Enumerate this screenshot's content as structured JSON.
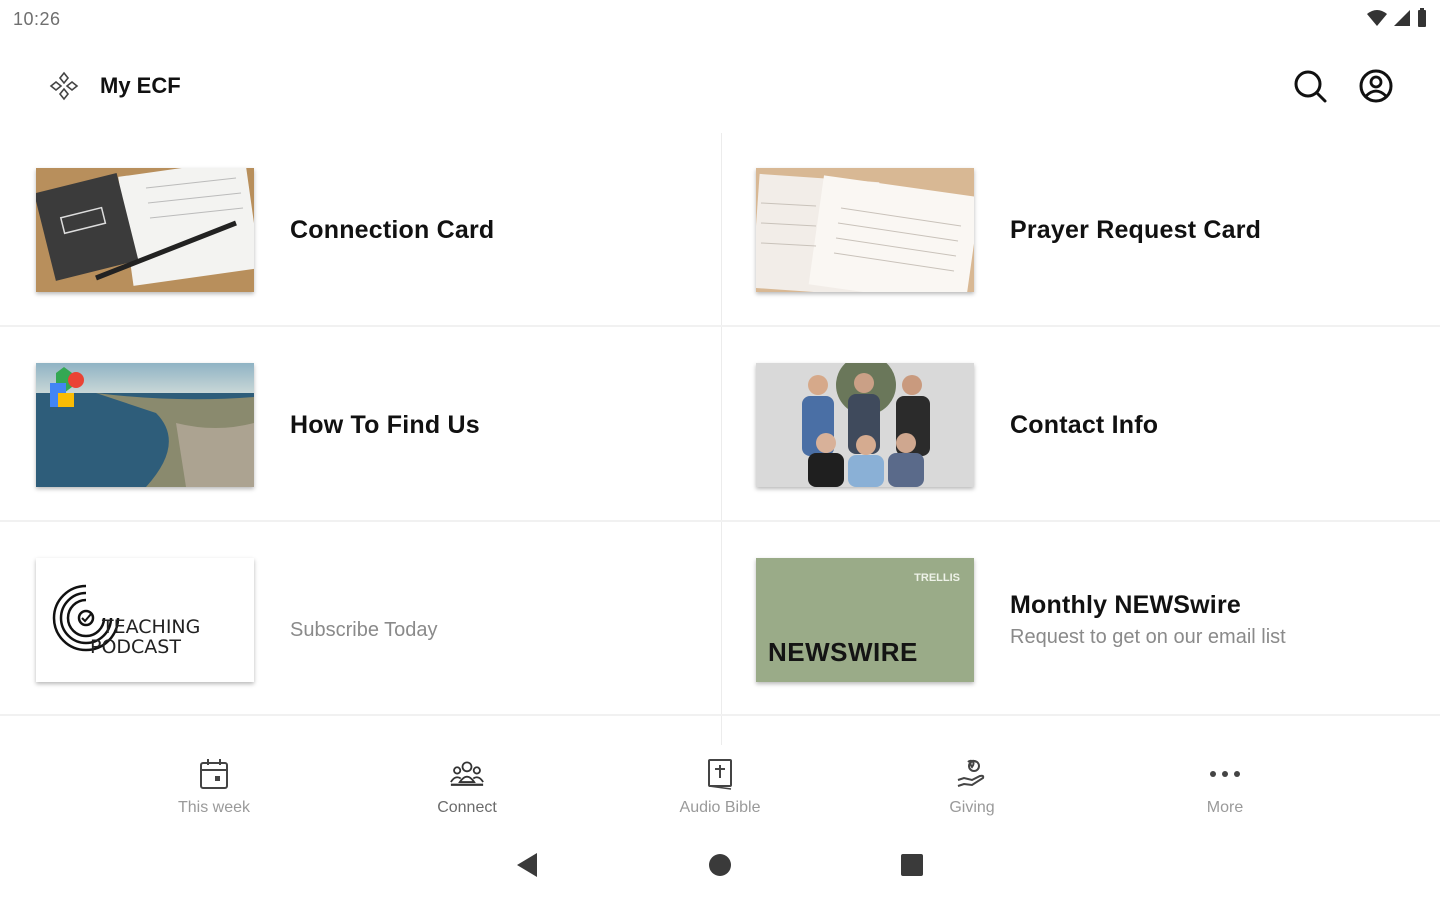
{
  "status_bar": {
    "time": "10:26"
  },
  "app_bar": {
    "title": "My ECF",
    "logo_icon": "ecf-logo-icon",
    "search_icon": "search-icon",
    "account_icon": "account-circle-icon"
  },
  "cards": [
    {
      "title": "Connection Card",
      "subtitle": "",
      "thumb": "connection-card-photo"
    },
    {
      "title": "Prayer Request Card",
      "subtitle": "",
      "thumb": "prayer-card-photo"
    },
    {
      "title": "How To Find Us",
      "subtitle": "",
      "thumb": "aerial-map-photo"
    },
    {
      "title": "Contact Info",
      "subtitle": "",
      "thumb": "staff-group-photo"
    },
    {
      "title": "",
      "subtitle": "Subscribe Today",
      "thumb": "teaching-podcast-logo",
      "thumb_text_1": "TEACHING",
      "thumb_text_2": "PODCAST"
    },
    {
      "title": "Monthly NEWSwire",
      "subtitle": "Request to get on our email list",
      "thumb": "newswire-graphic",
      "thumb_text_1": "NEWSWIRE",
      "thumb_text_2": "TRELLIS"
    }
  ],
  "bottom_nav": {
    "items": [
      {
        "label": "This week",
        "icon": "calendar-icon"
      },
      {
        "label": "Connect",
        "icon": "group-icon",
        "active": true
      },
      {
        "label": "Audio Bible",
        "icon": "bible-icon"
      },
      {
        "label": "Giving",
        "icon": "giving-hand-icon"
      },
      {
        "label": "More",
        "icon": "more-dots-icon"
      }
    ]
  },
  "colors": {
    "text_primary": "#111111",
    "text_secondary": "#8a8a8a",
    "nav_inactive": "#9a9a9a",
    "newswire_green": "#9aab88"
  }
}
